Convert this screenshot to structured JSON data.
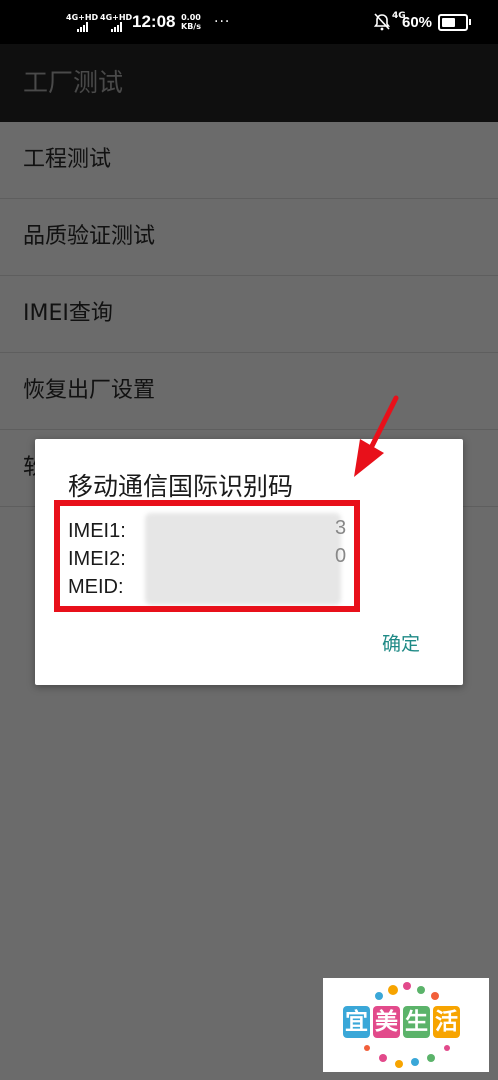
{
  "status_bar": {
    "sim1": "4G+HD",
    "sim2": "4G+HD",
    "time": "12:08",
    "speed_value": "0.00",
    "speed_unit": "KB/s",
    "dots": "···",
    "network": "4G",
    "battery": "60%",
    "battery_level": 0.6
  },
  "app_bar": {
    "title": "工厂测试"
  },
  "menu": {
    "items": [
      {
        "label": "工程测试"
      },
      {
        "label": "品质验证测试"
      },
      {
        "label": "IMEI查询"
      },
      {
        "label": "恢复出厂设置"
      },
      {
        "label": "软"
      }
    ]
  },
  "dialog": {
    "title": "移动通信国际识别码",
    "imei1_label": "IMEI1:",
    "imei2_label": "IMEI2:",
    "meid_label": "MEID:",
    "imei1_tail": "3",
    "imei2_tail": "0",
    "ok_label": "确定"
  },
  "watermark": {
    "text": "宜美生活"
  },
  "colors": {
    "highlight": "#e8101a",
    "accent": "#1f8a86"
  }
}
